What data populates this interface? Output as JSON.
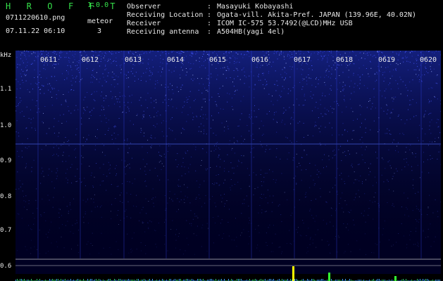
{
  "header": {
    "app_title": "H R O F F T",
    "app_version": "1.0.0",
    "file_name": "0711220610.png",
    "datetime": "07.11.22 06:10",
    "meteor_label": "meteor",
    "meteor_count": "3",
    "info": [
      {
        "label": "Observer",
        "value": "Masayuki Kobayashi"
      },
      {
        "label": "Receiving Location",
        "value": "Ogata-vill. Akita-Pref. JAPAN (139.96E, 40.02N)"
      },
      {
        "label": "Receiver",
        "value": "ICOM IC-575 53.7492(@LCD)MHz USB"
      },
      {
        "label": "Receiving antenna",
        "value": "A504HB(yagi 4el)"
      }
    ],
    "separator": ":"
  },
  "spectrogram": {
    "freq_unit": "kHz",
    "freq_ticks": [
      "1.1",
      "1.0",
      "0.9",
      "0.8",
      "0.7",
      "0.6"
    ],
    "time_ticks": [
      "0611",
      "0612",
      "0613",
      "0614",
      "0615",
      "0616",
      "0617",
      "0618",
      "0619",
      "0620"
    ],
    "colors": {
      "background": "#000033",
      "signal": "#3a4cff",
      "grid": "#ffffff",
      "marker": "#ffff00",
      "level": "#2ecc71"
    }
  }
}
